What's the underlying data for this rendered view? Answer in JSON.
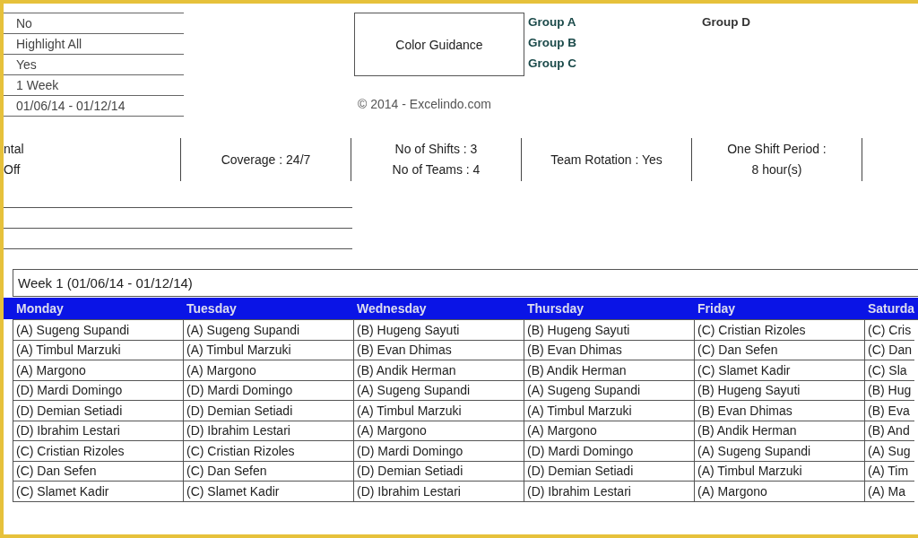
{
  "settings": [
    "No",
    "Highlight All",
    "Yes",
    "1 Week",
    "01/06/14 - 01/12/14"
  ],
  "color_guidance": {
    "label": "Color Guidance",
    "groups": [
      "Group A",
      "Group B",
      "Group C",
      "Group D"
    ]
  },
  "copyright": "© 2014 - Excelindo.com",
  "summary": [
    [
      "ntal",
      "Off"
    ],
    [
      "Coverage : 24/7"
    ],
    [
      "No of Shifts : 3",
      "No of Teams : 4"
    ],
    [
      "Team Rotation : Yes"
    ],
    [
      "One Shift Period :",
      "8 hour(s)"
    ]
  ],
  "schedule": {
    "title": "Week 1 (01/06/14 - 01/12/14)",
    "columns": [
      "Monday",
      "Tuesday",
      "Wednesday",
      "Thursday",
      "Friday",
      "Saturda"
    ],
    "rows": [
      [
        "(A) Sugeng Supandi",
        "(A) Sugeng Supandi",
        "(B) Hugeng Sayuti",
        "(B) Hugeng Sayuti",
        "(C) Cristian Rizoles",
        "(C) Cris"
      ],
      [
        "(A) Timbul Marzuki",
        "(A) Timbul Marzuki",
        "(B) Evan Dhimas",
        "(B) Evan Dhimas",
        "(C) Dan Sefen",
        "(C) Dan"
      ],
      [
        "(A) Margono",
        "(A) Margono",
        "(B) Andik Herman",
        "(B) Andik Herman",
        "(C) Slamet Kadir",
        "(C) Sla"
      ],
      [
        "(D) Mardi Domingo",
        "(D) Mardi Domingo",
        "(A) Sugeng Supandi",
        "(A) Sugeng Supandi",
        "(B) Hugeng Sayuti",
        "(B) Hug"
      ],
      [
        "(D) Demian Setiadi",
        "(D) Demian Setiadi",
        "(A) Timbul Marzuki",
        "(A) Timbul Marzuki",
        "(B) Evan Dhimas",
        "(B) Eva"
      ],
      [
        "(D) Ibrahim Lestari",
        "(D) Ibrahim Lestari",
        "(A) Margono",
        "(A) Margono",
        "(B) Andik Herman",
        "(B) And"
      ],
      [
        "(C) Cristian Rizoles",
        "(C) Cristian Rizoles",
        "(D) Mardi Domingo",
        "(D) Mardi Domingo",
        "(A) Sugeng Supandi",
        "(A) Sug"
      ],
      [
        "(C) Dan Sefen",
        "(C) Dan Sefen",
        "(D) Demian Setiadi",
        "(D) Demian Setiadi",
        "(A) Timbul Marzuki",
        "(A) Tim"
      ],
      [
        "(C) Slamet Kadir",
        "(C) Slamet Kadir",
        "(D) Ibrahim Lestari",
        "(D) Ibrahim Lestari",
        "(A) Margono",
        "(A) Ma"
      ]
    ]
  }
}
